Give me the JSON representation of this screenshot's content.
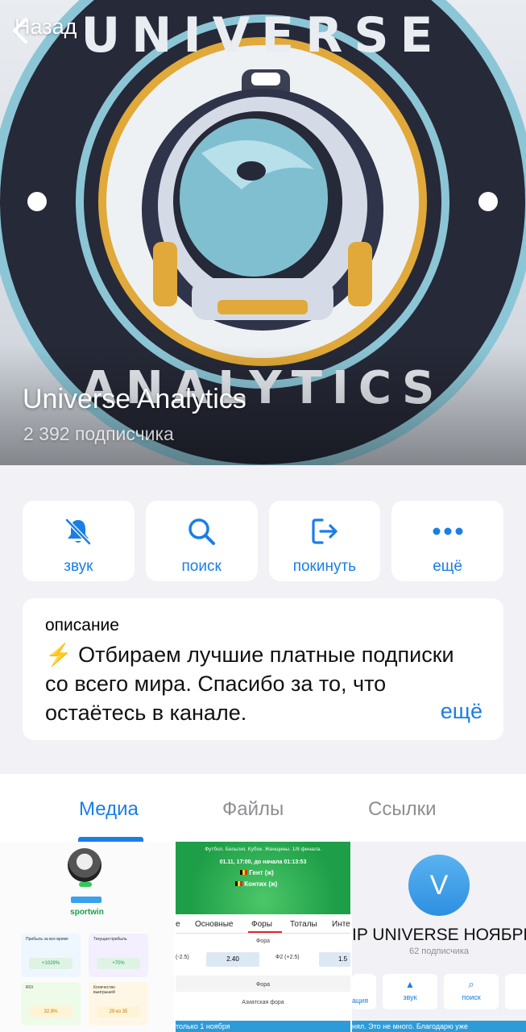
{
  "header": {
    "back_label": "Назад",
    "channel_name": "Universe Analytics",
    "subscribers": "2 392 подписчика"
  },
  "actions": [
    {
      "label": "звук",
      "icon": "bell-slash-icon"
    },
    {
      "label": "поиск",
      "icon": "search-icon"
    },
    {
      "label": "покинуть",
      "icon": "leave-icon"
    },
    {
      "label": "ещё",
      "icon": "more-icon"
    }
  ],
  "description": {
    "label": "описание",
    "text": "⚡ Отбираем лучшие платные подписки со всего мира. Спасибо за то, что остаётесь в канале.",
    "more_label": "ещё"
  },
  "tabs": [
    {
      "label": "Медиа",
      "active": true
    },
    {
      "label": "Файлы",
      "active": false
    },
    {
      "label": "Ссылки",
      "active": false
    }
  ],
  "media": {
    "tile1": {
      "app_name": "sportwin",
      "stats": [
        {
          "label": "Прибыль за все время",
          "value": "+1029%"
        },
        {
          "label": "Текущая прибыль",
          "value": "+70%"
        },
        {
          "label": "ROI",
          "value": "32.8%"
        },
        {
          "label": "Количество выигрышей",
          "value": "29 из 35"
        }
      ]
    },
    "tile2": {
      "match_title": "Футбол. Бельгия. Кубок. Женщины. 1/8 финала.",
      "match_time": "01.11, 17:00, до начала 01:13:53",
      "team1": "Гент (ж)",
      "team2": "Контих (ж)",
      "market_tabs": [
        "е",
        "Основные",
        "Форы",
        "Тоталы",
        "Инте"
      ],
      "section1": "Фора",
      "row1_left": "(-2.5)",
      "row1_odds": "2.40",
      "row1_right": "Ф2 (+2.5)",
      "row1_odds2": "1.5",
      "section2": "Фора",
      "section3": "Азиатская фора",
      "footer": "только 1 ноября"
    },
    "tile3": {
      "avatar_letter": "V",
      "title": "IP UNIVERSE НОЯБРЬ",
      "subs": "62 подписчика",
      "buttons": [
        "ация",
        "звук",
        "поиск"
      ],
      "footer": "нял. Это не много. Благодарю уже"
    }
  },
  "colors": {
    "accent": "#1a7ee6",
    "background": "#f1f1f6",
    "logo_dark": "#262937",
    "logo_blue": "#7fbfd0",
    "logo_gold": "#e0a93a"
  }
}
